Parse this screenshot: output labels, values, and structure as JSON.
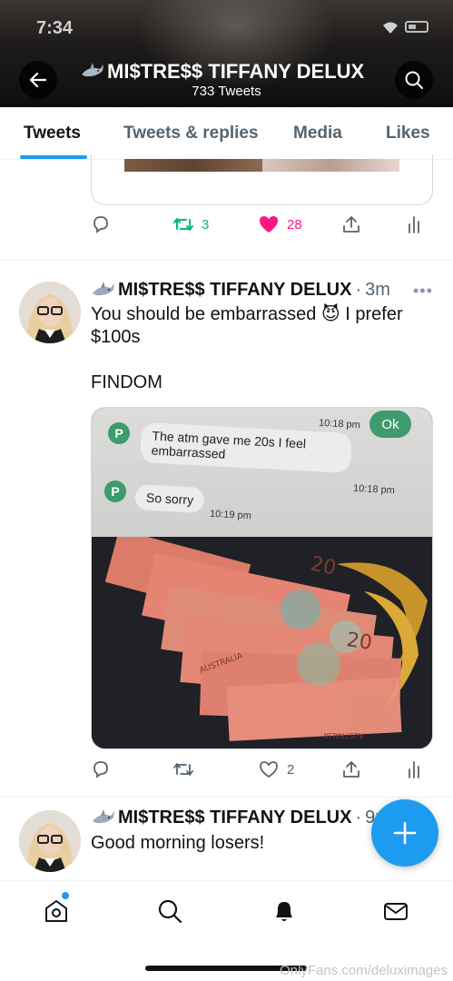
{
  "status_bar": {
    "time": "7:34"
  },
  "header": {
    "title": "MI$TRE$$ TIFFANY DELUX",
    "title_emoji": "shark",
    "tweet_count": "733 Tweets",
    "back_icon": "arrow-left-icon",
    "search_icon": "search-icon"
  },
  "tabs": [
    {
      "label": "Tweets",
      "active": true
    },
    {
      "label": "Tweets & replies",
      "active": false
    },
    {
      "label": "Media",
      "active": false
    },
    {
      "label": "Likes",
      "active": false
    }
  ],
  "prev_tweet": {
    "retweets": "3",
    "likes": "28",
    "retweeted": true,
    "liked": true
  },
  "tweets": [
    {
      "author": "MI$TRE$$ TIFFANY DELUX",
      "separator": "·",
      "time": "3m",
      "text_line1": "You should be embarrassed 😈 I prefer",
      "text_line2": "$100s",
      "text_line3": "FINDOM",
      "media": {
        "chat_ok": "Ok",
        "chat_ok_time": "10:18 pm",
        "msg1": "The atm gave me 20s I feel embarrassed",
        "msg1_time": "10:18 pm",
        "msg2": "So sorry",
        "msg2_time": "10:19 pm",
        "avatar_letter": "P",
        "banknote_text": "AUSTRALIA",
        "banknote_value": "20"
      },
      "likes": "2",
      "retweets": ""
    },
    {
      "author": "MI$TRE$$ TIFFANY DELUX",
      "separator": "·",
      "time": "9m",
      "text_line1": "Good morning losers!"
    }
  ],
  "watermark": "OnlyFans.com/deluximages",
  "colors": {
    "accent": "#1d9bf0",
    "retweet": "#00ba7c",
    "like": "#f91880",
    "muted": "#536471"
  }
}
